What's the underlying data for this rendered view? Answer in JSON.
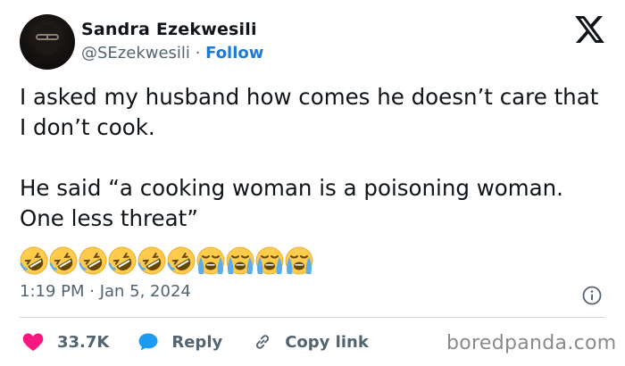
{
  "author": {
    "name": "Sandra Ezekwesili",
    "handle": "@SEzekwesili",
    "separator": "·",
    "follow_label": "Follow",
    "avatar_icon": "profile-photo"
  },
  "platform_icon": "x-logo-icon",
  "tweet": {
    "text": "I asked my husband how comes he doesn’t care that I don’t cook.\n\nHe said “a cooking woman is a poisoning woman. One less threat”",
    "emojis": [
      "rolling-on-floor-laughing",
      "rolling-on-floor-laughing",
      "rolling-on-floor-laughing",
      "rolling-on-floor-laughing",
      "rolling-on-floor-laughing",
      "rolling-on-floor-laughing",
      "loudly-crying",
      "loudly-crying",
      "loudly-crying",
      "loudly-crying"
    ]
  },
  "timestamp": "1:19 PM · Jan 5, 2024",
  "actions": {
    "likes": "33.7K",
    "reply_label": "Reply",
    "copy_link_label": "Copy link"
  },
  "watermark": "boredpanda.com",
  "colors": {
    "like": "#f91880",
    "reply": "#1d9bf0",
    "follow": "#1d7bd8",
    "secondary_text": "#536471",
    "divider": "#cfd9de"
  }
}
